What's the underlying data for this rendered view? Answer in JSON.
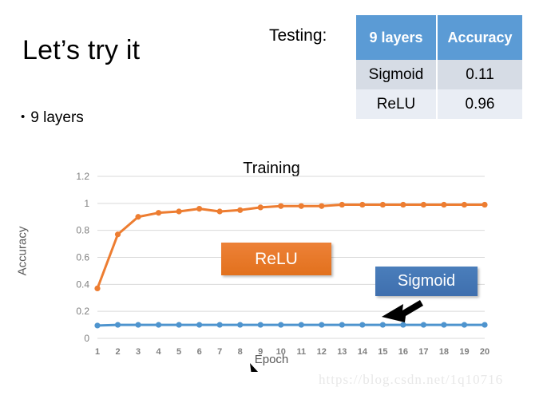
{
  "slide": {
    "title": "Let’s try it",
    "bullet_marker": "•",
    "bullet_text": "9 layers",
    "watermark": "https://blog.csdn.net/1q10716"
  },
  "testing": {
    "label": "Testing:",
    "table": {
      "headers": [
        "9 layers",
        "Accuracy"
      ],
      "rows": [
        [
          "Sigmoid",
          "0.11"
        ],
        [
          "ReLU",
          "0.96"
        ]
      ],
      "header_bg": "#5B9BD5",
      "row1_bg": "#D6DCE5",
      "row2_bg": "#E9EDF4"
    }
  },
  "annotations": {
    "relu_callout": "ReLU",
    "sigmoid_callout": "Sigmoid",
    "relu_callout_color": "#E2711D",
    "sigmoid_callout_color": "#4A7EBB"
  },
  "chart_data": {
    "type": "line",
    "title": "Training",
    "xlabel": "Epoch",
    "ylabel": "Accuracy",
    "x": [
      1,
      2,
      3,
      4,
      5,
      6,
      7,
      8,
      9,
      10,
      11,
      12,
      13,
      14,
      15,
      16,
      17,
      18,
      19,
      20
    ],
    "categories": [
      "1",
      "2",
      "3",
      "4",
      "5",
      "6",
      "7",
      "8",
      "9",
      "10",
      "11",
      "12",
      "13",
      "14",
      "15",
      "16",
      "17",
      "18",
      "19",
      "20"
    ],
    "xlim": [
      1,
      20
    ],
    "ylim": [
      0,
      1.2
    ],
    "yticks": [
      "0",
      "0.2",
      "0.4",
      "0.6",
      "0.8",
      "1",
      "1.2"
    ],
    "ytick_values": [
      0,
      0.2,
      0.4,
      0.6,
      0.8,
      1.0,
      1.2
    ],
    "grid": "horizontal",
    "legend": "none",
    "series": [
      {
        "name": "ReLU",
        "color": "#ED7D31",
        "values": [
          0.37,
          0.77,
          0.9,
          0.93,
          0.94,
          0.96,
          0.94,
          0.95,
          0.97,
          0.98,
          0.98,
          0.98,
          0.99,
          0.99,
          0.99,
          0.99,
          0.99,
          0.99,
          0.99,
          0.99
        ]
      },
      {
        "name": "Sigmoid",
        "color": "#4E94CE",
        "values": [
          0.095,
          0.1,
          0.1,
          0.1,
          0.1,
          0.1,
          0.1,
          0.1,
          0.1,
          0.1,
          0.1,
          0.1,
          0.1,
          0.1,
          0.1,
          0.1,
          0.1,
          0.1,
          0.1,
          0.1
        ]
      }
    ]
  }
}
